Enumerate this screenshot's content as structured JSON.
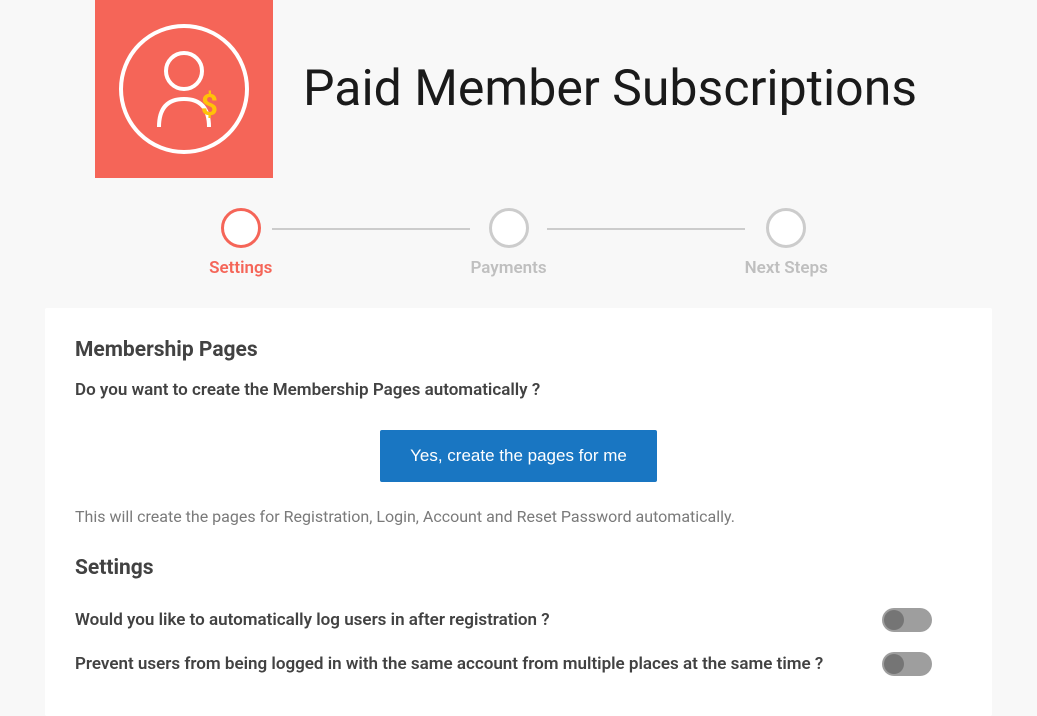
{
  "header": {
    "title": "Paid Member Subscriptions"
  },
  "stepper": {
    "steps": [
      {
        "label": "Settings",
        "active": true
      },
      {
        "label": "Payments",
        "active": false
      },
      {
        "label": "Next Steps",
        "active": false
      }
    ]
  },
  "membership": {
    "section_title": "Membership Pages",
    "question": "Do you want to create the Membership Pages automatically ?",
    "button_label": "Yes, create the pages for me",
    "hint": "This will create the pages for Registration, Login, Account and Reset Password automatically."
  },
  "settings": {
    "section_title": "Settings",
    "rows": [
      {
        "label": "Would you like to automatically log users in after registration ?"
      },
      {
        "label": "Prevent users from being logged in with the same account from multiple places at the same time ?"
      }
    ]
  }
}
